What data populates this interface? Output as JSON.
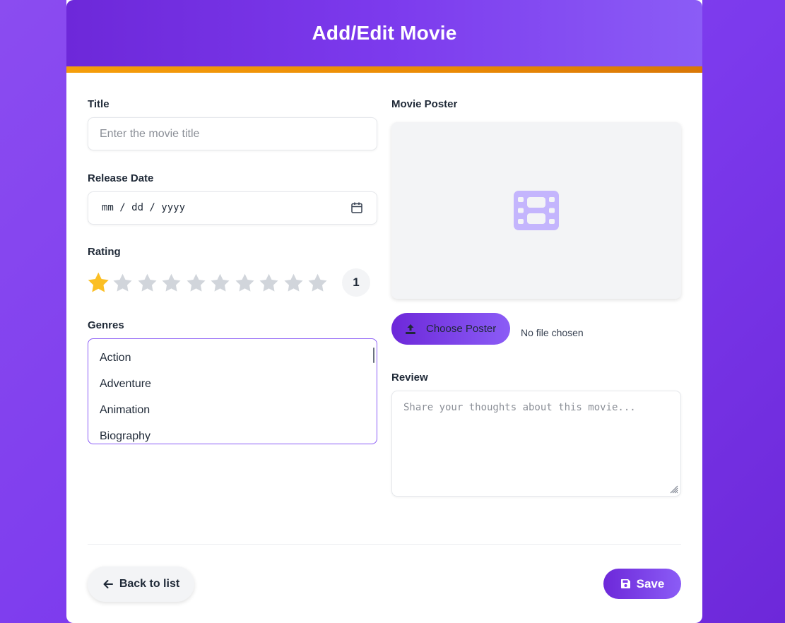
{
  "header": {
    "title": "Add/Edit Movie"
  },
  "colors": {
    "brand": "#7c3aed",
    "accent": "#f59e0b",
    "star_active": "#fbbf24",
    "star_inactive": "#d1d5db"
  },
  "form": {
    "title": {
      "label": "Title",
      "value": "",
      "placeholder": "Enter the movie title"
    },
    "release_date": {
      "label": "Release Date",
      "display": "mm / dd / yyyy",
      "icon": "calendar-icon"
    },
    "rating": {
      "label": "Rating",
      "value": 1,
      "max": 10,
      "display": "1"
    },
    "genres": {
      "label": "Genres",
      "options": [
        "Action",
        "Adventure",
        "Animation",
        "Biography"
      ]
    },
    "poster": {
      "label": "Movie Poster",
      "placeholder_icon": "film-icon",
      "button_label": "Choose Poster",
      "button_icon": "upload-icon",
      "file_status": "No file chosen"
    },
    "review": {
      "label": "Review",
      "value": "",
      "placeholder": "Share your thoughts about this movie..."
    }
  },
  "footer": {
    "back_label": "Back to list",
    "back_icon": "arrow-left-icon",
    "save_label": "Save",
    "save_icon": "floppy-disk-icon"
  }
}
